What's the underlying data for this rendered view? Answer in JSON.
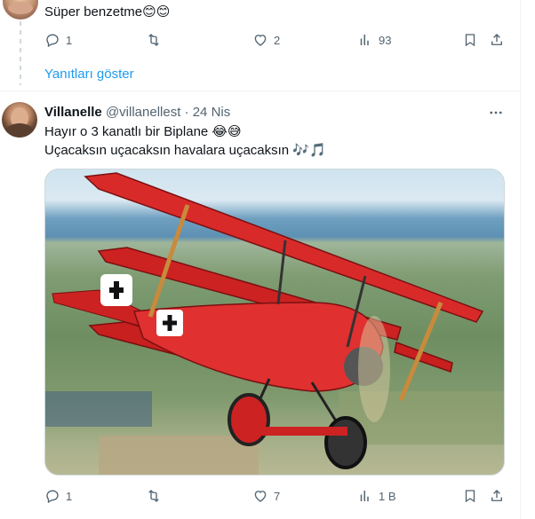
{
  "top_tweet": {
    "text": "Süper benzetme😊😊",
    "reply_count": "1",
    "retweet_count": "",
    "like_count": "2",
    "view_count": "93"
  },
  "show_replies_label": "Yanıtları göster",
  "tweet": {
    "name": "Villanelle",
    "handle": "@villanellest",
    "separator": "·",
    "date": "24 Nis",
    "line1": "Hayır o 3 kanatlı bir Biplane 😂😅",
    "line2": "Uçacaksın uçacaksın havalara uçacaksın 🎶🎵",
    "media_description": "Red triplane",
    "reply_count": "1",
    "retweet_count": "",
    "like_count": "7",
    "view_count": "1 B"
  },
  "colors": {
    "link": "#1d9bf0",
    "muted": "#536471",
    "text": "#0f1419",
    "border": "#eff3f4"
  },
  "icons": [
    "reply-icon",
    "retweet-icon",
    "like-icon",
    "views-icon",
    "bookmark-icon",
    "share-icon",
    "more-icon"
  ]
}
